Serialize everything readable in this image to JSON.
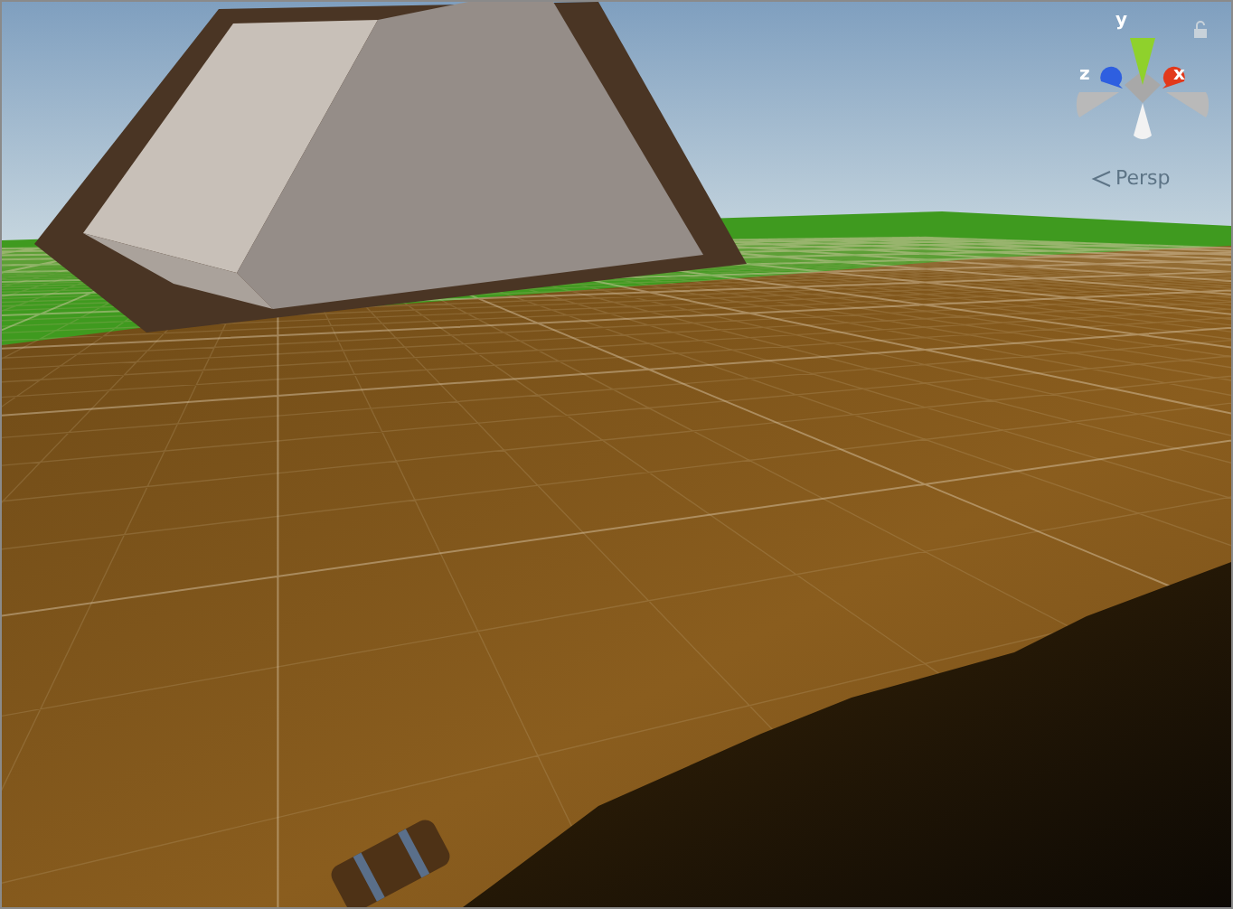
{
  "gizmo": {
    "axes": [
      {
        "label": "y",
        "color": "#8fd12c"
      },
      {
        "label": "z",
        "color": "#2e5fe0"
      },
      {
        "label": "x",
        "color": "#e2391b"
      }
    ]
  },
  "projection": {
    "label": "Persp"
  }
}
